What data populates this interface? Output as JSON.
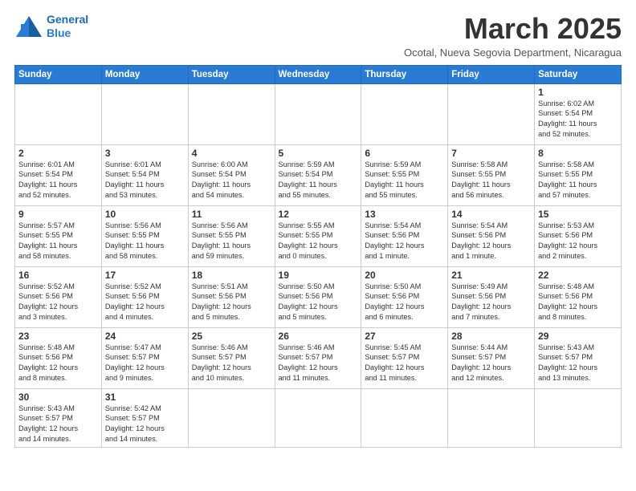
{
  "logo": {
    "line1": "General",
    "line2": "Blue"
  },
  "title": "March 2025",
  "subtitle": "Ocotal, Nueva Segovia Department, Nicaragua",
  "weekdays": [
    "Sunday",
    "Monday",
    "Tuesday",
    "Wednesday",
    "Thursday",
    "Friday",
    "Saturday"
  ],
  "weeks": [
    [
      {
        "day": "",
        "info": ""
      },
      {
        "day": "",
        "info": ""
      },
      {
        "day": "",
        "info": ""
      },
      {
        "day": "",
        "info": ""
      },
      {
        "day": "",
        "info": ""
      },
      {
        "day": "",
        "info": ""
      },
      {
        "day": "1",
        "info": "Sunrise: 6:02 AM\nSunset: 5:54 PM\nDaylight: 11 hours\nand 52 minutes."
      }
    ],
    [
      {
        "day": "2",
        "info": "Sunrise: 6:01 AM\nSunset: 5:54 PM\nDaylight: 11 hours\nand 52 minutes."
      },
      {
        "day": "3",
        "info": "Sunrise: 6:01 AM\nSunset: 5:54 PM\nDaylight: 11 hours\nand 53 minutes."
      },
      {
        "day": "4",
        "info": "Sunrise: 6:00 AM\nSunset: 5:54 PM\nDaylight: 11 hours\nand 54 minutes."
      },
      {
        "day": "5",
        "info": "Sunrise: 5:59 AM\nSunset: 5:54 PM\nDaylight: 11 hours\nand 55 minutes."
      },
      {
        "day": "6",
        "info": "Sunrise: 5:59 AM\nSunset: 5:55 PM\nDaylight: 11 hours\nand 55 minutes."
      },
      {
        "day": "7",
        "info": "Sunrise: 5:58 AM\nSunset: 5:55 PM\nDaylight: 11 hours\nand 56 minutes."
      },
      {
        "day": "8",
        "info": "Sunrise: 5:58 AM\nSunset: 5:55 PM\nDaylight: 11 hours\nand 57 minutes."
      }
    ],
    [
      {
        "day": "9",
        "info": "Sunrise: 5:57 AM\nSunset: 5:55 PM\nDaylight: 11 hours\nand 58 minutes."
      },
      {
        "day": "10",
        "info": "Sunrise: 5:56 AM\nSunset: 5:55 PM\nDaylight: 11 hours\nand 58 minutes."
      },
      {
        "day": "11",
        "info": "Sunrise: 5:56 AM\nSunset: 5:55 PM\nDaylight: 11 hours\nand 59 minutes."
      },
      {
        "day": "12",
        "info": "Sunrise: 5:55 AM\nSunset: 5:55 PM\nDaylight: 12 hours\nand 0 minutes."
      },
      {
        "day": "13",
        "info": "Sunrise: 5:54 AM\nSunset: 5:56 PM\nDaylight: 12 hours\nand 1 minute."
      },
      {
        "day": "14",
        "info": "Sunrise: 5:54 AM\nSunset: 5:56 PM\nDaylight: 12 hours\nand 1 minute."
      },
      {
        "day": "15",
        "info": "Sunrise: 5:53 AM\nSunset: 5:56 PM\nDaylight: 12 hours\nand 2 minutes."
      }
    ],
    [
      {
        "day": "16",
        "info": "Sunrise: 5:52 AM\nSunset: 5:56 PM\nDaylight: 12 hours\nand 3 minutes."
      },
      {
        "day": "17",
        "info": "Sunrise: 5:52 AM\nSunset: 5:56 PM\nDaylight: 12 hours\nand 4 minutes."
      },
      {
        "day": "18",
        "info": "Sunrise: 5:51 AM\nSunset: 5:56 PM\nDaylight: 12 hours\nand 5 minutes."
      },
      {
        "day": "19",
        "info": "Sunrise: 5:50 AM\nSunset: 5:56 PM\nDaylight: 12 hours\nand 5 minutes."
      },
      {
        "day": "20",
        "info": "Sunrise: 5:50 AM\nSunset: 5:56 PM\nDaylight: 12 hours\nand 6 minutes."
      },
      {
        "day": "21",
        "info": "Sunrise: 5:49 AM\nSunset: 5:56 PM\nDaylight: 12 hours\nand 7 minutes."
      },
      {
        "day": "22",
        "info": "Sunrise: 5:48 AM\nSunset: 5:56 PM\nDaylight: 12 hours\nand 8 minutes."
      }
    ],
    [
      {
        "day": "23",
        "info": "Sunrise: 5:48 AM\nSunset: 5:56 PM\nDaylight: 12 hours\nand 8 minutes."
      },
      {
        "day": "24",
        "info": "Sunrise: 5:47 AM\nSunset: 5:57 PM\nDaylight: 12 hours\nand 9 minutes."
      },
      {
        "day": "25",
        "info": "Sunrise: 5:46 AM\nSunset: 5:57 PM\nDaylight: 12 hours\nand 10 minutes."
      },
      {
        "day": "26",
        "info": "Sunrise: 5:46 AM\nSunset: 5:57 PM\nDaylight: 12 hours\nand 11 minutes."
      },
      {
        "day": "27",
        "info": "Sunrise: 5:45 AM\nSunset: 5:57 PM\nDaylight: 12 hours\nand 11 minutes."
      },
      {
        "day": "28",
        "info": "Sunrise: 5:44 AM\nSunset: 5:57 PM\nDaylight: 12 hours\nand 12 minutes."
      },
      {
        "day": "29",
        "info": "Sunrise: 5:43 AM\nSunset: 5:57 PM\nDaylight: 12 hours\nand 13 minutes."
      }
    ],
    [
      {
        "day": "30",
        "info": "Sunrise: 5:43 AM\nSunset: 5:57 PM\nDaylight: 12 hours\nand 14 minutes."
      },
      {
        "day": "31",
        "info": "Sunrise: 5:42 AM\nSunset: 5:57 PM\nDaylight: 12 hours\nand 14 minutes."
      },
      {
        "day": "",
        "info": ""
      },
      {
        "day": "",
        "info": ""
      },
      {
        "day": "",
        "info": ""
      },
      {
        "day": "",
        "info": ""
      },
      {
        "day": "",
        "info": ""
      }
    ]
  ]
}
